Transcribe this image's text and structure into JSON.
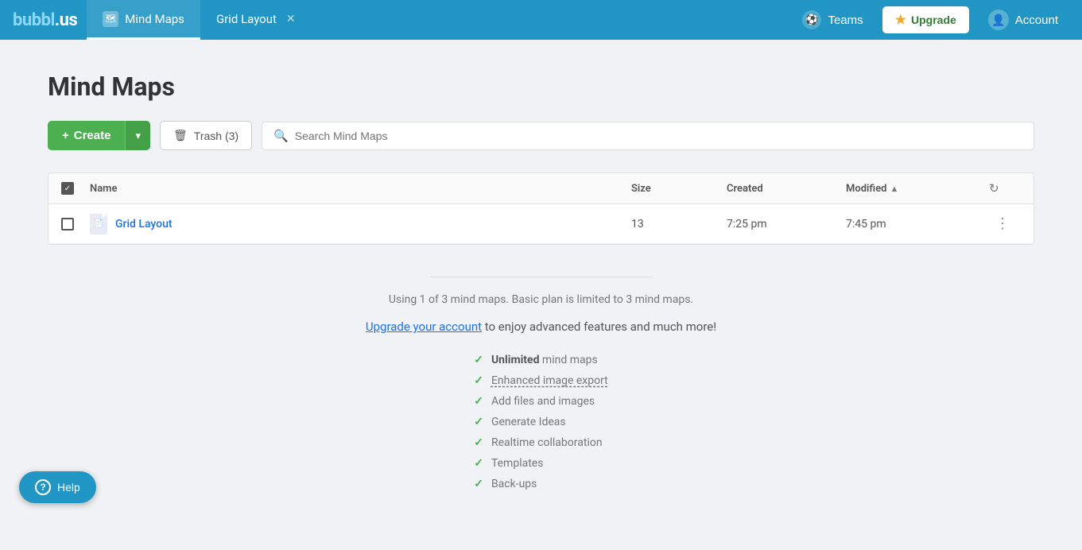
{
  "header": {
    "logo": "bubbl.us",
    "tabs": [
      {
        "id": "mind-maps",
        "label": "Mind Maps",
        "active": true,
        "closable": false
      },
      {
        "id": "grid-layout",
        "label": "Grid Layout",
        "active": false,
        "closable": true
      }
    ],
    "teams_label": "Teams",
    "upgrade_label": "Upgrade",
    "account_label": "Account"
  },
  "toolbar": {
    "create_label": "Create",
    "trash_label": "Trash (3)",
    "search_placeholder": "Search Mind Maps"
  },
  "page": {
    "title": "Mind Maps"
  },
  "table": {
    "columns": [
      "Name",
      "Size",
      "Created",
      "Modified"
    ],
    "rows": [
      {
        "name": "Grid Layout",
        "size": "13",
        "created": "7:25 pm",
        "modified": "7:45 pm"
      }
    ]
  },
  "upgrade_section": {
    "usage_text": "Using 1 of 3 mind maps. Basic plan is limited to 3 mind maps.",
    "upgrade_link": "Upgrade your account",
    "upgrade_suffix": " to enjoy advanced features and much more!",
    "features": [
      {
        "bold": "Unlimited",
        "text": " mind maps"
      },
      {
        "bold": "",
        "text": "Enhanced image export",
        "dashed": true
      },
      {
        "bold": "",
        "text": "Add files and images"
      },
      {
        "bold": "",
        "text": "Generate Ideas"
      },
      {
        "bold": "",
        "text": "Realtime collaboration"
      },
      {
        "bold": "",
        "text": "Templates"
      },
      {
        "bold": "",
        "text": "Back-ups"
      }
    ]
  },
  "help": {
    "label": "Help"
  }
}
